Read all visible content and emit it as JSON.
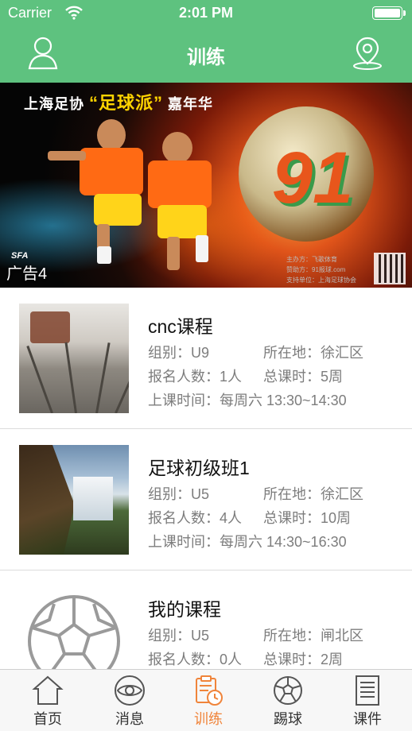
{
  "status_bar": {
    "carrier": "Carrier",
    "time": "2:01 PM"
  },
  "header": {
    "title": "训练",
    "left_icon": "user-icon",
    "right_icon": "location-pin-icon"
  },
  "banner": {
    "headline_left": "上海足协",
    "headline_quote": "“足球派”",
    "headline_right": "嘉年华",
    "ball_number": "91",
    "credits": [
      "主办方：飞歌体育",
      "赞助方：91报球.com",
      "支持单位：上海足球协会"
    ],
    "logo_text": "SFA",
    "badge": "广告4"
  },
  "courses": [
    {
      "name": "cnc课程",
      "group_label": "组别：U9",
      "location_label": "所在地：徐汇区",
      "enrolled_label": "报名人数：1人",
      "hours_label": "总课时：5周",
      "time_label": "上课时间：每周六 13:30~14:30",
      "thumb": "city-rail-photo"
    },
    {
      "name": "足球初级班1",
      "group_label": "组别：U5",
      "location_label": "所在地：徐汇区",
      "enrolled_label": "报名人数：4人",
      "hours_label": "总课时：10周",
      "time_label": "上课时间：每周六 14:30~16:30",
      "thumb": "waterfall-photo"
    },
    {
      "name": "我的课程",
      "group_label": "组别：U5",
      "location_label": "所在地：闸北区",
      "enrolled_label": "报名人数：0人",
      "hours_label": "总课时：2周",
      "thumb": "soccer-ball-icon"
    }
  ],
  "tabs": [
    {
      "label": "首页",
      "icon": "home-icon",
      "active": false
    },
    {
      "label": "消息",
      "icon": "eye-icon",
      "active": false
    },
    {
      "label": "训练",
      "icon": "clipboard-clock-icon",
      "active": true
    },
    {
      "label": "踢球",
      "icon": "soccer-ball-icon",
      "active": false
    },
    {
      "label": "课件",
      "icon": "document-icon",
      "active": false
    }
  ],
  "colors": {
    "header_green": "#5ec27f",
    "active_tab": "#f0843a",
    "text_gray": "#7d7d7d"
  }
}
